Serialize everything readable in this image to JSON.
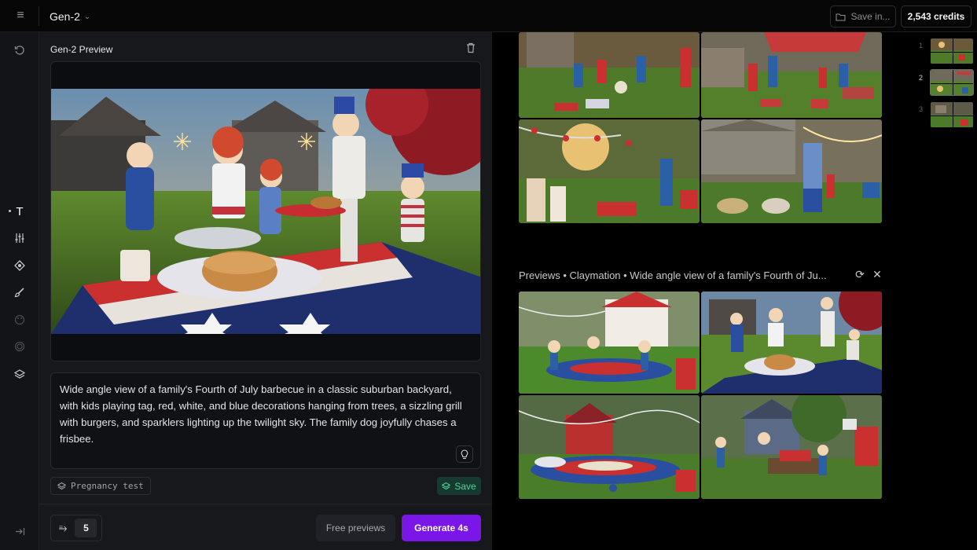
{
  "topbar": {
    "model": "Gen-2",
    "save_in": "Save in...",
    "credits": "2,543 credits"
  },
  "rail": {
    "icons": [
      "history-icon",
      "text-icon",
      "sliders-icon",
      "motion-brush-icon",
      "style-brush-icon",
      "palette-icon",
      "circle-icon",
      "layers-icon"
    ],
    "active_label": "T"
  },
  "panel": {
    "title": "Gen-2 Preview",
    "prompt": "Wide angle view of a family's Fourth of July barbecue in a classic suburban backyard, with kids playing tag, red, white, and blue decorations hanging from trees, a sizzling grill with burgers, and sparklers lighting up the twilight sky. The family dog joyfully chases a frisbee.",
    "style_chip": "Pregnancy test",
    "save_label": "Save",
    "count": "5",
    "free_previews_label": "Free previews",
    "generate_label": "Generate 4s"
  },
  "gallery": {
    "previews_title": "Previews • Claymation • Wide angle view of a family's Fourth of Ju..."
  },
  "timeline": {
    "items": [
      "1",
      "2",
      "3"
    ],
    "active_index": 1
  },
  "colors": {
    "accent": "#7a16e8",
    "save_green": "#53d19b",
    "panel_bg": "#16181c"
  }
}
